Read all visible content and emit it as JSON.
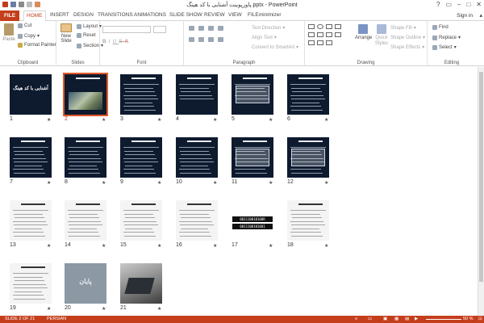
{
  "window": {
    "title": "پاورپوینت آشنایی با کد هینگ.pptx - PowerPoint",
    "sign_in": "Sign in"
  },
  "tabs": [
    "FILE",
    "HOME",
    "INSERT",
    "DESIGN",
    "TRANSITIONS",
    "ANIMATIONS",
    "SLIDE SHOW",
    "REVIEW",
    "VIEW",
    "FILEminimizer"
  ],
  "ribbon": {
    "clipboard": {
      "paste": "Paste",
      "cut": "Cut",
      "copy": "Copy",
      "format_painter": "Format Painter",
      "label": "Clipboard"
    },
    "slides": {
      "new_slide": "New Slide",
      "layout": "Layout",
      "reset": "Reset",
      "section": "Section",
      "label": "Slides"
    },
    "font": {
      "label": "Font"
    },
    "paragraph": {
      "text_direction": "Text Direction",
      "align_text": "Align Text",
      "convert": "Convert to SmartArt",
      "label": "Paragraph"
    },
    "drawing": {
      "arrange": "Arrange",
      "quick_styles": "Quick Styles",
      "shape_fill": "Shape Fill",
      "shape_outline": "Shape Outline",
      "shape_effects": "Shape Effects",
      "label": "Drawing"
    },
    "editing": {
      "find": "Find",
      "replace": "Replace",
      "select": "Select",
      "label": "Editing"
    }
  },
  "slides": [
    {
      "n": "1"
    },
    {
      "n": "2"
    },
    {
      "n": "3"
    },
    {
      "n": "4"
    },
    {
      "n": "5"
    },
    {
      "n": "6"
    },
    {
      "n": "7"
    },
    {
      "n": "8"
    },
    {
      "n": "9"
    },
    {
      "n": "10"
    },
    {
      "n": "11"
    },
    {
      "n": "12"
    },
    {
      "n": "13"
    },
    {
      "n": "14"
    },
    {
      "n": "15"
    },
    {
      "n": "16"
    },
    {
      "n": "17"
    },
    {
      "n": "18"
    },
    {
      "n": "19"
    },
    {
      "n": "20"
    },
    {
      "n": "21"
    }
  ],
  "slide_texts": {
    "s1": "آشنایی با کد هینگ",
    "s17a": "001110010100R",
    "s17b": "0011100101001",
    "s20": "پایان"
  },
  "status": {
    "slide": "SLIDE 2 OF 21",
    "lang": "PERSIAN",
    "zoom": "50 %"
  },
  "colors": {
    "accent": "#c43e1c",
    "slide_dark": "#0e1a2e",
    "selection": "#e05a2a"
  }
}
